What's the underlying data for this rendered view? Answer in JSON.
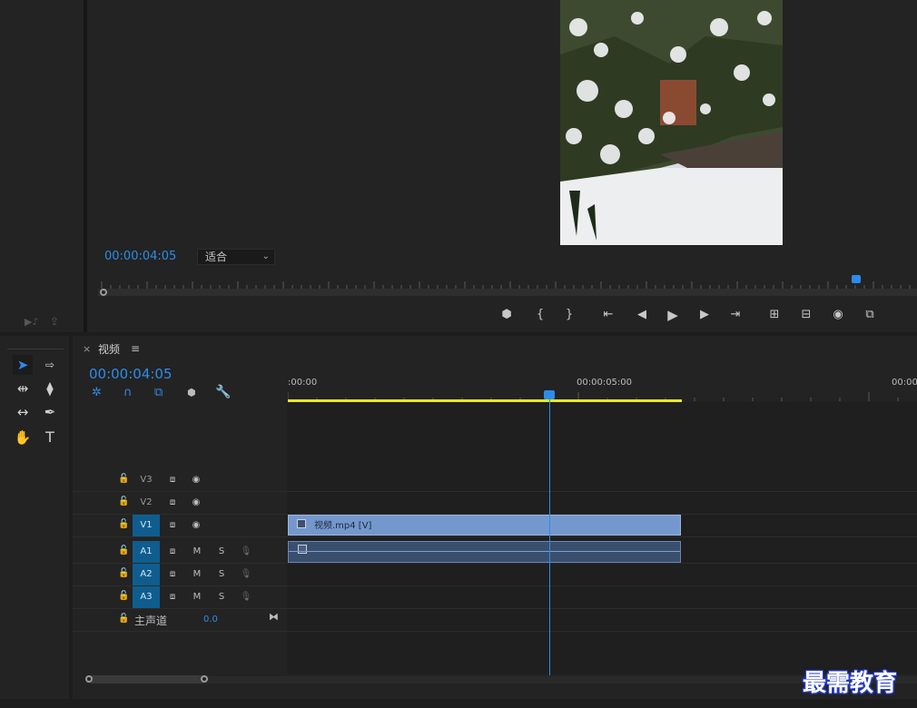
{
  "program_monitor": {
    "timecode": "00:00:04:05",
    "fit_label": "适合",
    "transport_buttons": [
      {
        "name": "add-marker",
        "glyph": "⬢"
      },
      {
        "name": "mark-in",
        "glyph": "{"
      },
      {
        "name": "mark-out",
        "glyph": "}"
      },
      {
        "name": "go-to-in",
        "glyph": "⇤"
      },
      {
        "name": "step-back",
        "glyph": "◀"
      },
      {
        "name": "play",
        "glyph": "▶"
      },
      {
        "name": "step-forward",
        "glyph": "▶"
      },
      {
        "name": "go-to-out",
        "glyph": "⇥"
      },
      {
        "name": "lift",
        "glyph": "⊞"
      },
      {
        "name": "extract",
        "glyph": "⊟"
      },
      {
        "name": "export-frame",
        "glyph": "◉"
      },
      {
        "name": "button-editor",
        "glyph": "⧉"
      }
    ]
  },
  "timeline": {
    "tab_label": "视频",
    "close_glyph": "×",
    "menu_glyph": "≡",
    "timecode": "00:00:04:05",
    "ruler_labels": [
      ":00:00",
      "00:00:05:00",
      "00:00"
    ],
    "video_tracks": [
      {
        "name": "V3",
        "selected": false
      },
      {
        "name": "V2",
        "selected": false
      },
      {
        "name": "V1",
        "selected": true
      }
    ],
    "audio_tracks": [
      {
        "name": "A1",
        "m": "M",
        "s": "S"
      },
      {
        "name": "A2",
        "m": "M",
        "s": "S"
      },
      {
        "name": "A3",
        "m": "M",
        "s": "S"
      }
    ],
    "master_label": "主声道",
    "master_value": "0.0",
    "clip_label": "视频.mp4 [V]",
    "playhead_position_fraction": 0.415
  },
  "watermark": "最需教育",
  "colors": {
    "accent_blue": "#2d8ceb",
    "clip_video": "#7498cd",
    "clip_audio": "#3a4f6e",
    "work_area": "#e8e821"
  }
}
